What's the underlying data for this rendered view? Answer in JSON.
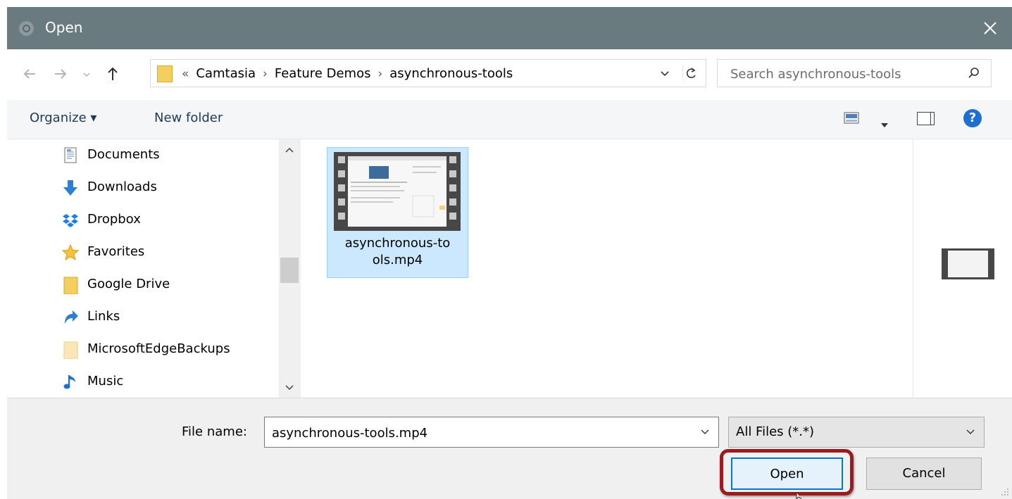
{
  "window": {
    "title": "Open"
  },
  "address_bar": {
    "overflow": "«",
    "crumbs": [
      "Camtasia",
      "Feature Demos",
      "asynchronous-tools"
    ]
  },
  "search": {
    "placeholder": "Search asynchronous-tools"
  },
  "toolbar": {
    "organize_label": "Organize ▾",
    "new_folder_label": "New folder",
    "help_label": "?"
  },
  "nav_pane": {
    "items": [
      {
        "label": "Documents",
        "icon": "documents-icon"
      },
      {
        "label": "Downloads",
        "icon": "downloads-icon"
      },
      {
        "label": "Dropbox",
        "icon": "dropbox-icon"
      },
      {
        "label": "Favorites",
        "icon": "favorites-star-icon"
      },
      {
        "label": "Google Drive",
        "icon": "folder-icon"
      },
      {
        "label": "Links",
        "icon": "links-icon"
      },
      {
        "label": "MicrosoftEdgeBackups",
        "icon": "folder-pale-icon"
      },
      {
        "label": "Music",
        "icon": "music-icon"
      }
    ]
  },
  "content": {
    "files": [
      {
        "name_line1": "asynchronous-to",
        "name_line2": "ols.mp4"
      }
    ]
  },
  "bottom": {
    "file_name_label": "File name:",
    "file_name_value": "asynchronous-tools.mp4",
    "file_type": "All Files (*.*)",
    "open_label": "Open",
    "cancel_label": "Cancel"
  },
  "colors": {
    "titlebar": "#6a7b80",
    "selection": "#cce8ff",
    "highlight_ring": "#9b1c1f",
    "accent": "#0078d7"
  }
}
